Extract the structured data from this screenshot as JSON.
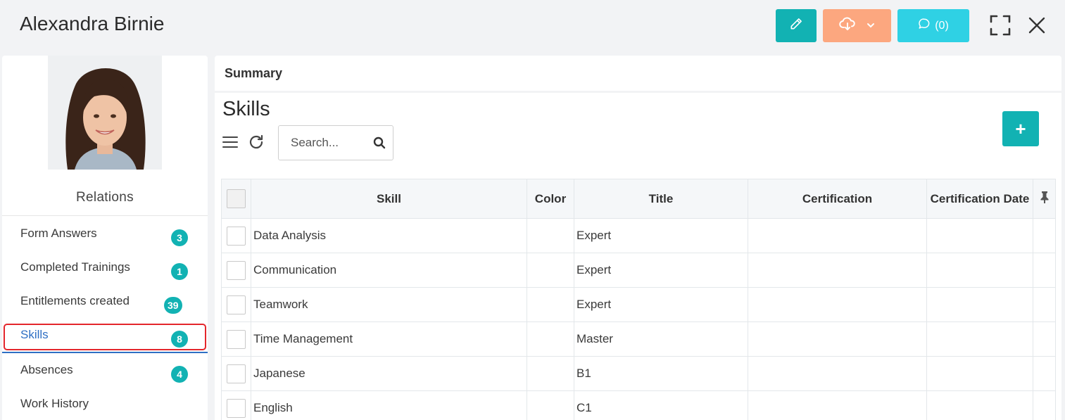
{
  "header": {
    "title": "Alexandra Birnie",
    "comments_label": "(0)"
  },
  "colors": {
    "edit": "#12b2b3",
    "download": "#fca77f",
    "comments": "#2fd1e4",
    "badge": "#12b2b3",
    "active_link": "#2e6fc4",
    "highlight": "#e4262c"
  },
  "relations": {
    "heading": "Relations",
    "items": [
      {
        "label": "Form Answers",
        "count": "3"
      },
      {
        "label": "Completed Trainings",
        "count": "1"
      },
      {
        "label": "Entitlements created",
        "count": "39"
      },
      {
        "label": "Skills",
        "count": "8"
      },
      {
        "label": "Absences",
        "count": "4"
      },
      {
        "label": "Work History",
        "count": ""
      }
    ]
  },
  "summary": {
    "label": "Summary"
  },
  "skills": {
    "title": "Skills",
    "search_placeholder": "Search...",
    "add_label": "+",
    "columns": [
      "Skill",
      "Color",
      "Title",
      "Certification",
      "Certification Date"
    ],
    "rows": [
      {
        "skill": "Data Analysis",
        "color": "",
        "title": "Expert",
        "certification": "",
        "certification_date": ""
      },
      {
        "skill": "Communication",
        "color": "",
        "title": "Expert",
        "certification": "",
        "certification_date": ""
      },
      {
        "skill": "Teamwork",
        "color": "",
        "title": "Expert",
        "certification": "",
        "certification_date": ""
      },
      {
        "skill": "Time Management",
        "color": "",
        "title": "Master",
        "certification": "",
        "certification_date": ""
      },
      {
        "skill": "Japanese",
        "color": "",
        "title": "B1",
        "certification": "",
        "certification_date": ""
      },
      {
        "skill": "English",
        "color": "",
        "title": "C1",
        "certification": "",
        "certification_date": ""
      }
    ]
  }
}
